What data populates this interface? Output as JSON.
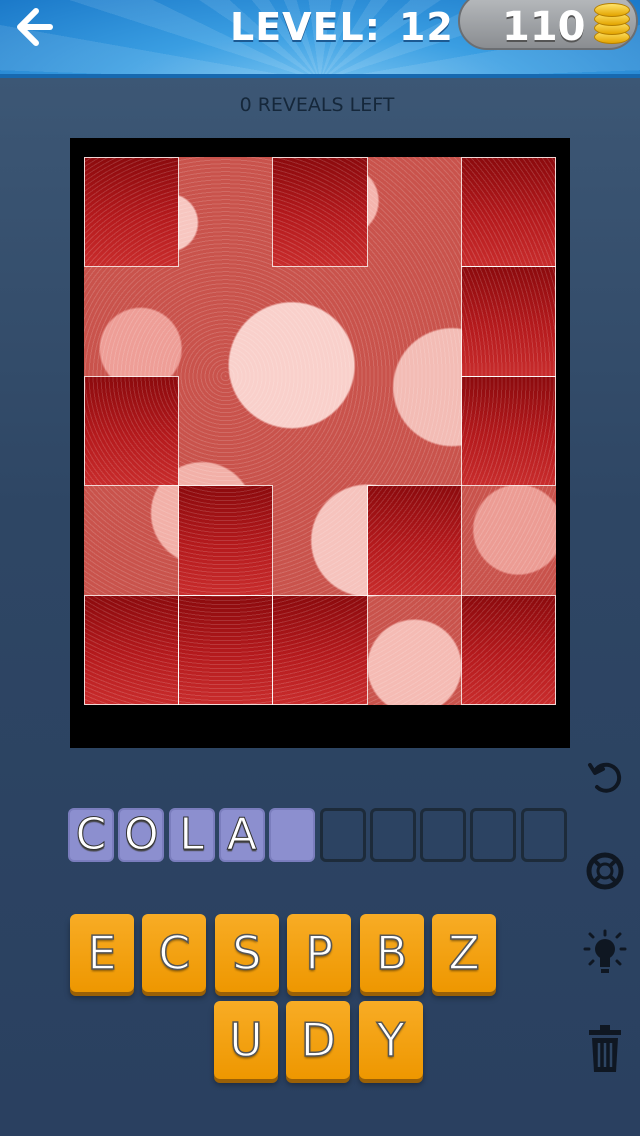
{
  "header": {
    "level_label": "LEVEL:",
    "level_number": "12",
    "coins": "110",
    "back_icon": "arrow-left-icon",
    "coin_icon": "coin-stack-icon"
  },
  "reveals_text": "0 REVEALS LEFT",
  "puzzle": {
    "grid_columns": 5,
    "grid_rows": 5,
    "covered_tiles": [
      [
        0,
        0
      ],
      [
        0,
        2
      ],
      [
        0,
        4
      ],
      [
        1,
        4
      ],
      [
        2,
        0
      ],
      [
        2,
        4
      ],
      [
        3,
        1
      ],
      [
        3,
        3
      ],
      [
        4,
        0
      ],
      [
        4,
        1
      ],
      [
        4,
        2
      ],
      [
        4,
        4
      ]
    ],
    "tile_color": "#b51a1d"
  },
  "answer": {
    "slots": [
      "C",
      "O",
      "L",
      "A",
      "",
      "",
      "",
      "",
      "",
      ""
    ],
    "filled_count": 5,
    "slot_color": "#8c8fcf"
  },
  "keys": {
    "row1": [
      "E",
      "C",
      "S",
      "P",
      "B",
      "Z"
    ],
    "row2": [
      "U",
      "D",
      "Y"
    ],
    "key_color": "#f5a31a"
  },
  "tools": [
    "undo-icon",
    "lifebuoy-icon",
    "lightbulb-icon",
    "trash-icon"
  ]
}
